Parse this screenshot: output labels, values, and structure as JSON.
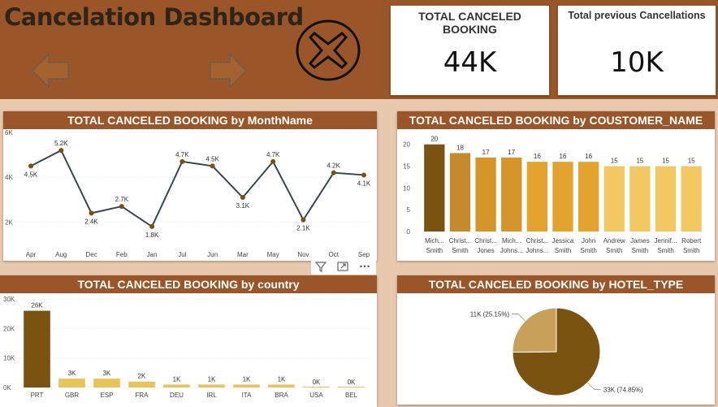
{
  "dashboard": {
    "title": "Cancelation Dashboard"
  },
  "cards": [
    {
      "label": "TOTAL CANCELED BOOKING",
      "value": "44K"
    },
    {
      "label": "Total previous Cancellations",
      "value": "10K"
    }
  ],
  "colors": {
    "banner": "#9a5628",
    "line": "#37474f",
    "marker": "#7a4f12",
    "pie_dark": "#7a5310",
    "pie_light": "#c9a05a"
  },
  "icons": {
    "back": "arrow-left-icon",
    "forward": "arrow-right-icon",
    "cancel": "x-circle-icon",
    "filter": "filter-icon",
    "focus": "focus-mode-icon",
    "more": "more-options-icon"
  },
  "toolbar": {
    "more_label": "···"
  },
  "chart_data": [
    {
      "type": "line",
      "title": "TOTAL CANCELED BOOKING by MonthName",
      "categories": [
        "Apr",
        "Aug",
        "Dec",
        "Feb",
        "Jan",
        "Jul",
        "Jun",
        "Mar",
        "May",
        "Nov",
        "Oct",
        "Sep"
      ],
      "values": [
        4500,
        5200,
        2400,
        2700,
        1800,
        4700,
        4500,
        3100,
        4700,
        2100,
        4200,
        4100
      ],
      "data_labels": [
        "4.5K",
        "5.2K",
        "2.4K",
        "2.7K",
        "1.8K",
        "4.7K",
        "4.5K",
        "3.1K",
        "4.7K",
        "2.1K",
        "4.2K",
        "4.1K"
      ],
      "y_ticks": [
        "6K",
        "4K",
        "2K"
      ],
      "ylim": [
        1000,
        6000
      ]
    },
    {
      "type": "bar",
      "title": "TOTAL CANCELED BOOKING by COUSTOMER_NAME",
      "categories": [
        [
          "Mich...",
          "Smith"
        ],
        [
          "Christ...",
          "Smith"
        ],
        [
          "Christ...",
          "Jones"
        ],
        [
          "Mich...",
          "Johns..."
        ],
        [
          "Christ...",
          "Johns..."
        ],
        [
          "Jessica",
          "Smith"
        ],
        [
          "John",
          "Smith"
        ],
        [
          "Andrew",
          "Smith"
        ],
        [
          "James",
          "Smith"
        ],
        [
          "Jennif...",
          "Smith"
        ],
        [
          "Robert",
          "Smith"
        ]
      ],
      "values": [
        20,
        18,
        17,
        17,
        16,
        16,
        16,
        15,
        15,
        15,
        15
      ],
      "y_ticks": [
        "20",
        "15",
        "10",
        "5",
        "0"
      ],
      "ylim": [
        0,
        22
      ]
    },
    {
      "type": "bar",
      "title": "TOTAL CANCELED BOOKING by country",
      "categories": [
        "PRT",
        "GBR",
        "ESP",
        "FRA",
        "DEU",
        "IRL",
        "ITA",
        "BRA",
        "USA",
        "BEL"
      ],
      "values": [
        26000,
        3000,
        3000,
        2000,
        1000,
        1000,
        1000,
        1000,
        0,
        0
      ],
      "data_labels": [
        "26K",
        "3K",
        "3K",
        "2K",
        "1K",
        "1K",
        "1K",
        "1K",
        "0K",
        "0K"
      ],
      "y_ticks": [
        "30K",
        "20K",
        "10K",
        "0K"
      ],
      "ylim": [
        0,
        30000
      ]
    },
    {
      "type": "pie",
      "title": "TOTAL CANCELED BOOKING by HOTEL_TYPE",
      "slices": [
        {
          "value": 33000,
          "percent": 74.85,
          "label": "33K (74.85%)"
        },
        {
          "value": 11000,
          "percent": 25.15,
          "label": "11K (25.15%)"
        }
      ]
    }
  ]
}
